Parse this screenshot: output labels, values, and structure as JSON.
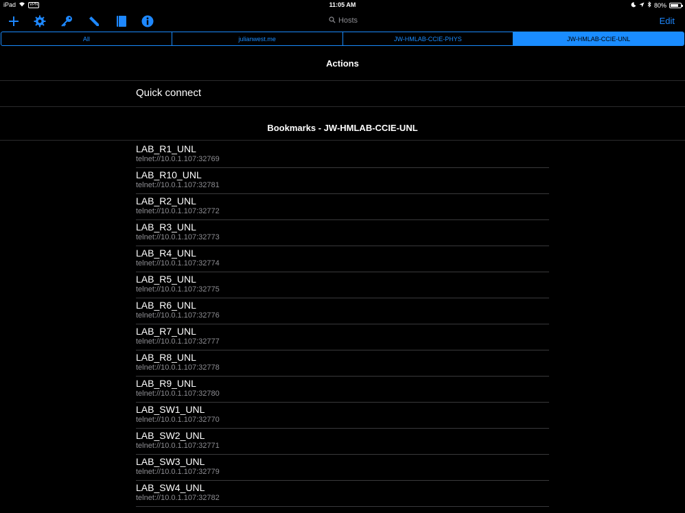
{
  "status_bar": {
    "device": "iPad",
    "vpn": "VPN",
    "time": "11:05 AM",
    "battery": "80%",
    "battery_level": 0.8
  },
  "toolbar": {
    "icons": [
      "plus-icon",
      "gear-icon",
      "key-icon",
      "pen-icon",
      "book-icon",
      "info-icon"
    ],
    "search_placeholder": "Hosts",
    "edit_label": "Edit",
    "accent_color": "#1e88ff"
  },
  "tabs": [
    {
      "label": "All",
      "active": false
    },
    {
      "label": "julianwest.me",
      "active": false
    },
    {
      "label": "JW-HMLAB-CCIE-PHYS",
      "active": false
    },
    {
      "label": "JW-HMLAB-CCIE-UNL",
      "active": true
    }
  ],
  "actions": {
    "header": "Actions",
    "quick_connect": "Quick connect"
  },
  "bookmarks": {
    "header": "Bookmarks - JW-HMLAB-CCIE-UNL",
    "items": [
      {
        "name": "LAB_R1_UNL",
        "url": "telnet://10.0.1.107:32769"
      },
      {
        "name": "LAB_R10_UNL",
        "url": "telnet://10.0.1.107:32781"
      },
      {
        "name": "LAB_R2_UNL",
        "url": "telnet://10.0.1.107:32772"
      },
      {
        "name": "LAB_R3_UNL",
        "url": "telnet://10.0.1.107:32773"
      },
      {
        "name": "LAB_R4_UNL",
        "url": "telnet://10.0.1.107:32774"
      },
      {
        "name": "LAB_R5_UNL",
        "url": "telnet://10.0.1.107:32775"
      },
      {
        "name": "LAB_R6_UNL",
        "url": "telnet://10.0.1.107:32776"
      },
      {
        "name": "LAB_R7_UNL",
        "url": "telnet://10.0.1.107:32777"
      },
      {
        "name": "LAB_R8_UNL",
        "url": "telnet://10.0.1.107:32778"
      },
      {
        "name": "LAB_R9_UNL",
        "url": "telnet://10.0.1.107:32780"
      },
      {
        "name": "LAB_SW1_UNL",
        "url": "telnet://10.0.1.107:32770"
      },
      {
        "name": "LAB_SW2_UNL",
        "url": "telnet://10.0.1.107:32771"
      },
      {
        "name": "LAB_SW3_UNL",
        "url": "telnet://10.0.1.107:32779"
      },
      {
        "name": "LAB_SW4_UNL",
        "url": "telnet://10.0.1.107:32782"
      }
    ]
  }
}
